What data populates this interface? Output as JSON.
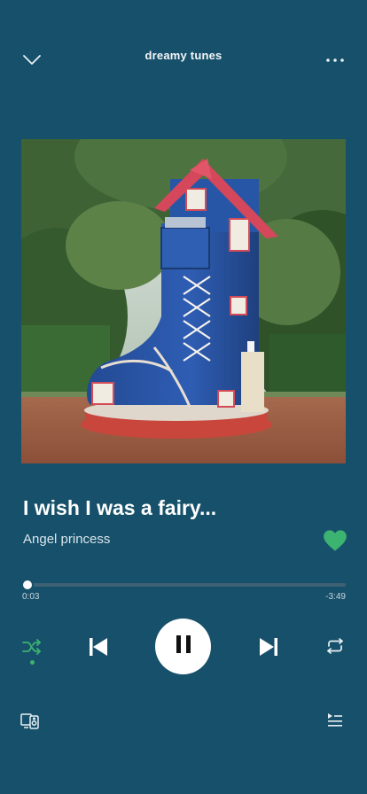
{
  "header": {
    "playlist_title": "dreamy tunes",
    "collapse_icon": "chevron-down-icon",
    "more_icon": "more-horizontal-icon"
  },
  "track": {
    "title": "I wish I was a fairy...",
    "artist": "Angel princess",
    "liked": true
  },
  "progress": {
    "elapsed": "0:03",
    "remaining": "-3:49",
    "fraction": 0.013
  },
  "controls": {
    "shuffle_icon": "shuffle-icon",
    "shuffle_active": true,
    "previous_icon": "skip-previous-icon",
    "play_state_icon": "pause-icon",
    "next_icon": "skip-next-icon",
    "repeat_icon": "repeat-icon"
  },
  "footer": {
    "devices_icon": "devices-icon",
    "queue_icon": "queue-icon"
  },
  "colors": {
    "background": "#17506a",
    "accent_green": "#3cb371",
    "text_primary": "#ffffff",
    "text_secondary": "#c8d7de"
  }
}
